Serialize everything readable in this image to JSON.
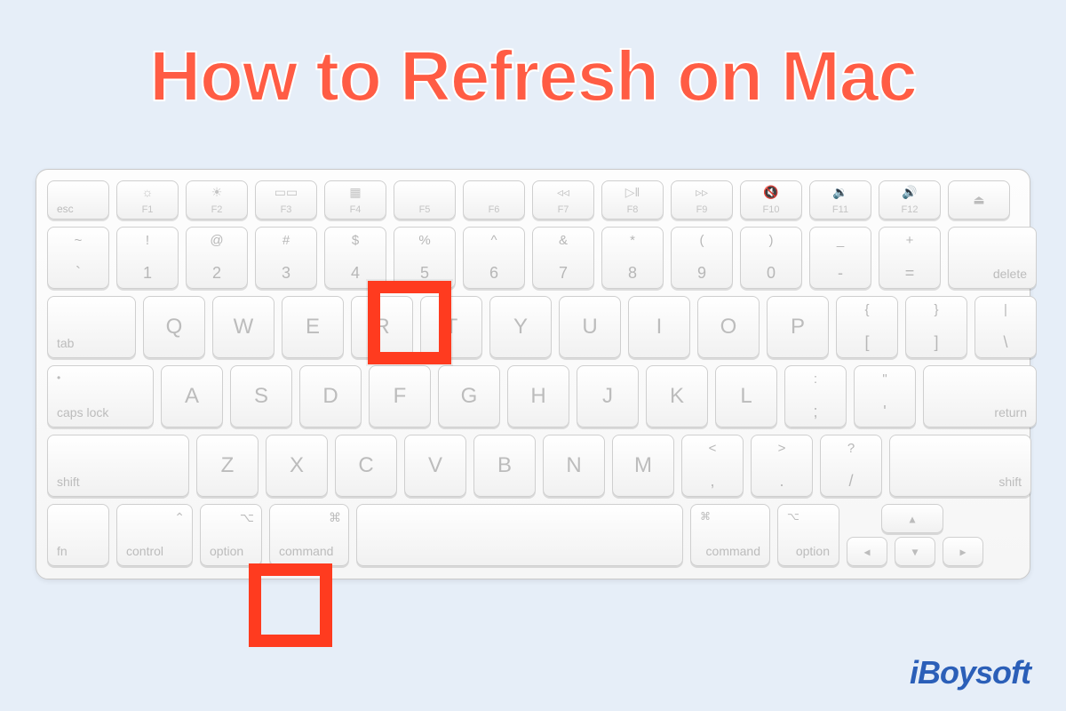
{
  "title": "How to Refresh on Mac",
  "logo": "iBoysoft",
  "colors": {
    "accent": "#ff5c44",
    "highlight": "#ff3b1f",
    "brand": "#2b5fb8",
    "bg": "#e6eef8"
  },
  "highlighted_keys": [
    "R",
    "command"
  ],
  "shortcut": "Command + R",
  "fn_row": [
    {
      "label": "esc",
      "icon": ""
    },
    {
      "label": "F1",
      "icon": "☼"
    },
    {
      "label": "F2",
      "icon": "☀"
    },
    {
      "label": "F3",
      "icon": "▭▭"
    },
    {
      "label": "F4",
      "icon": "▦"
    },
    {
      "label": "F5",
      "icon": ""
    },
    {
      "label": "F6",
      "icon": ""
    },
    {
      "label": "F7",
      "icon": "◃◃"
    },
    {
      "label": "F8",
      "icon": "▷ǁ"
    },
    {
      "label": "F9",
      "icon": "▹▹"
    },
    {
      "label": "F10",
      "icon": "🔇"
    },
    {
      "label": "F11",
      "icon": "🔉"
    },
    {
      "label": "F12",
      "icon": "🔊"
    },
    {
      "label": "⏏",
      "icon": ""
    }
  ],
  "num_row": [
    {
      "top": "~",
      "bot": "`"
    },
    {
      "top": "!",
      "bot": "1"
    },
    {
      "top": "@",
      "bot": "2"
    },
    {
      "top": "#",
      "bot": "3"
    },
    {
      "top": "$",
      "bot": "4"
    },
    {
      "top": "%",
      "bot": "5"
    },
    {
      "top": "^",
      "bot": "6"
    },
    {
      "top": "&",
      "bot": "7"
    },
    {
      "top": "*",
      "bot": "8"
    },
    {
      "top": "(",
      "bot": "9"
    },
    {
      "top": ")",
      "bot": "0"
    },
    {
      "top": "_",
      "bot": "-"
    },
    {
      "top": "+",
      "bot": "="
    }
  ],
  "num_row_end": "delete",
  "qwerty": [
    "Q",
    "W",
    "E",
    "R",
    "T",
    "Y",
    "U",
    "I",
    "O",
    "P"
  ],
  "qwerty_start": "tab",
  "brackets": [
    {
      "top": "{",
      "bot": "["
    },
    {
      "top": "}",
      "bot": "]"
    },
    {
      "top": "|",
      "bot": "\\"
    }
  ],
  "asdf_start": "caps lock",
  "asdf": [
    "A",
    "S",
    "D",
    "F",
    "G",
    "H",
    "J",
    "K",
    "L"
  ],
  "asdf_punct": [
    {
      "top": ":",
      "bot": ";"
    },
    {
      "top": "\"",
      "bot": "'"
    }
  ],
  "asdf_end": "return",
  "zxcv_start": "shift",
  "zxcv": [
    "Z",
    "X",
    "C",
    "V",
    "B",
    "N",
    "M"
  ],
  "zxcv_punct": [
    {
      "top": "<",
      "bot": ","
    },
    {
      "top": ">",
      "bot": "."
    },
    {
      "top": "?",
      "bot": "/"
    }
  ],
  "zxcv_end": "shift",
  "bottom": {
    "fn": "fn",
    "control": "control",
    "option_l": "option",
    "command_l": "command",
    "command_sym": "⌘",
    "option_sym": "⌥",
    "control_sym": "⌃",
    "command_r": "command",
    "option_r": "option"
  },
  "arrows": {
    "up": "▴",
    "left": "◂",
    "down": "▾",
    "right": "▸"
  }
}
